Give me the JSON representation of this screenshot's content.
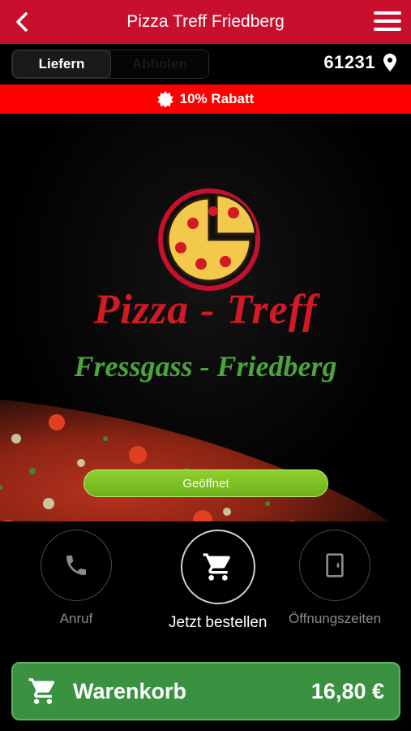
{
  "header": {
    "title": "Pizza Treff Friedberg",
    "back_icon": "chevron-left-icon",
    "menu_icon": "hamburger-icon"
  },
  "order_mode": {
    "options": [
      "Liefern",
      "Abholen"
    ],
    "selected": "Liefern"
  },
  "location": {
    "zip": "61231",
    "icon": "map-pin-icon"
  },
  "promo": {
    "text": "10% Rabatt",
    "icon": "badge-icon"
  },
  "hero": {
    "brand_line1": "Pizza - Treff",
    "brand_line2": "Fressgass - Friedberg",
    "status": "Geöffnet"
  },
  "actions": [
    {
      "label": "Anruf",
      "icon": "phone-icon"
    },
    {
      "label": "Jetzt bestellen",
      "icon": "cart-icon"
    },
    {
      "label": "Öffnungszeiten",
      "icon": "door-icon"
    }
  ],
  "cart": {
    "label": "Warenkorb",
    "total": "16,80 €",
    "icon": "cart-icon"
  },
  "colors": {
    "brand_red": "#c8102e",
    "promo_red": "#ff0000",
    "brand_green": "#4aa53b",
    "open_green": "#7cc225",
    "cart_green": "#3a9140"
  }
}
